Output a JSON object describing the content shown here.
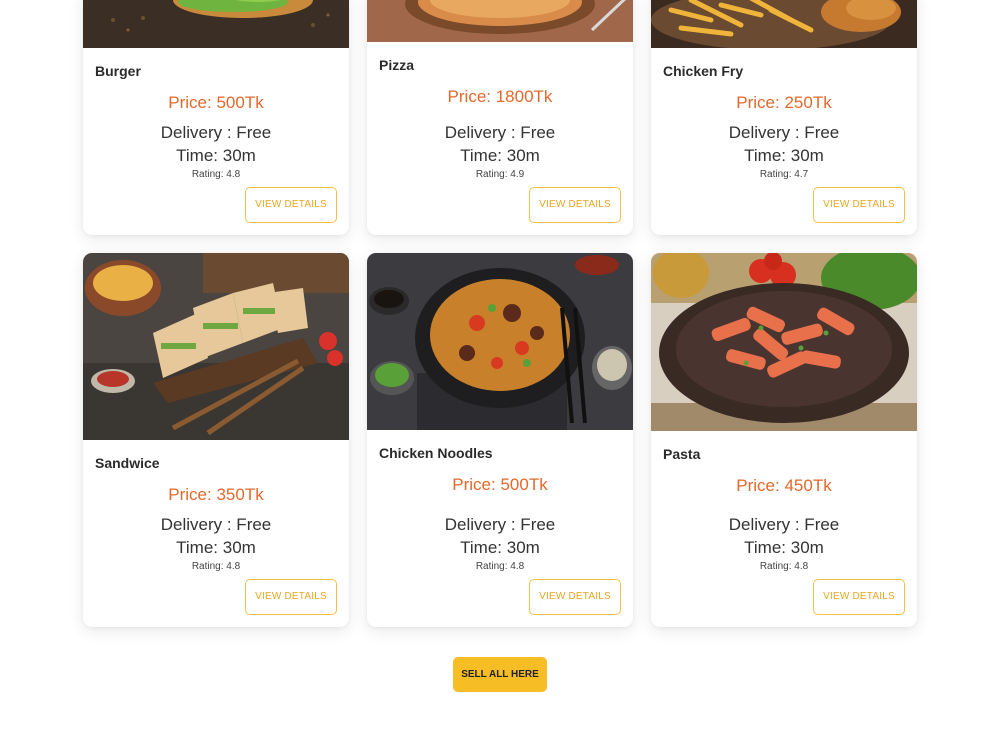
{
  "items": [
    {
      "name": "Burger",
      "price": "Price: 500Tk",
      "delivery": "Delivery : Free",
      "time": "Time: 30m",
      "rating": "Rating: 4.8",
      "button": "VIEW DETAILS",
      "image": "burger-photo"
    },
    {
      "name": "Pizza",
      "price": "Price: 1800Tk",
      "delivery": "Delivery : Free",
      "time": "Time: 30m",
      "rating": "Rating: 4.9",
      "button": "VIEW DETAILS",
      "image": "pizza-photo"
    },
    {
      "name": "Chicken Fry",
      "price": "Price: 250Tk",
      "delivery": "Delivery : Free",
      "time": "Time: 30m",
      "rating": "Rating: 4.7",
      "button": "VIEW DETAILS",
      "image": "chicken-fry-photo"
    },
    {
      "name": "Sandwice",
      "price": "Price: 350Tk",
      "delivery": "Delivery : Free",
      "time": "Time: 30m",
      "rating": "Rating: 4.8",
      "button": "VIEW DETAILS",
      "image": "sandwich-photo"
    },
    {
      "name": "Chicken Noodles",
      "price": "Price: 500Tk",
      "delivery": "Delivery : Free",
      "time": "Time: 30m",
      "rating": "Rating: 4.8",
      "button": "VIEW DETAILS",
      "image": "noodles-photo"
    },
    {
      "name": "Pasta",
      "price": "Price: 450Tk",
      "delivery": "Delivery : Free",
      "time": "Time: 30m",
      "rating": "Rating: 4.8",
      "button": "VIEW DETAILS",
      "image": "pasta-photo"
    }
  ],
  "sell_all_button": "SELL ALL HERE",
  "colors": {
    "price": "#e2682b",
    "accent": "#f7bd25",
    "outline": "#f4c048"
  }
}
